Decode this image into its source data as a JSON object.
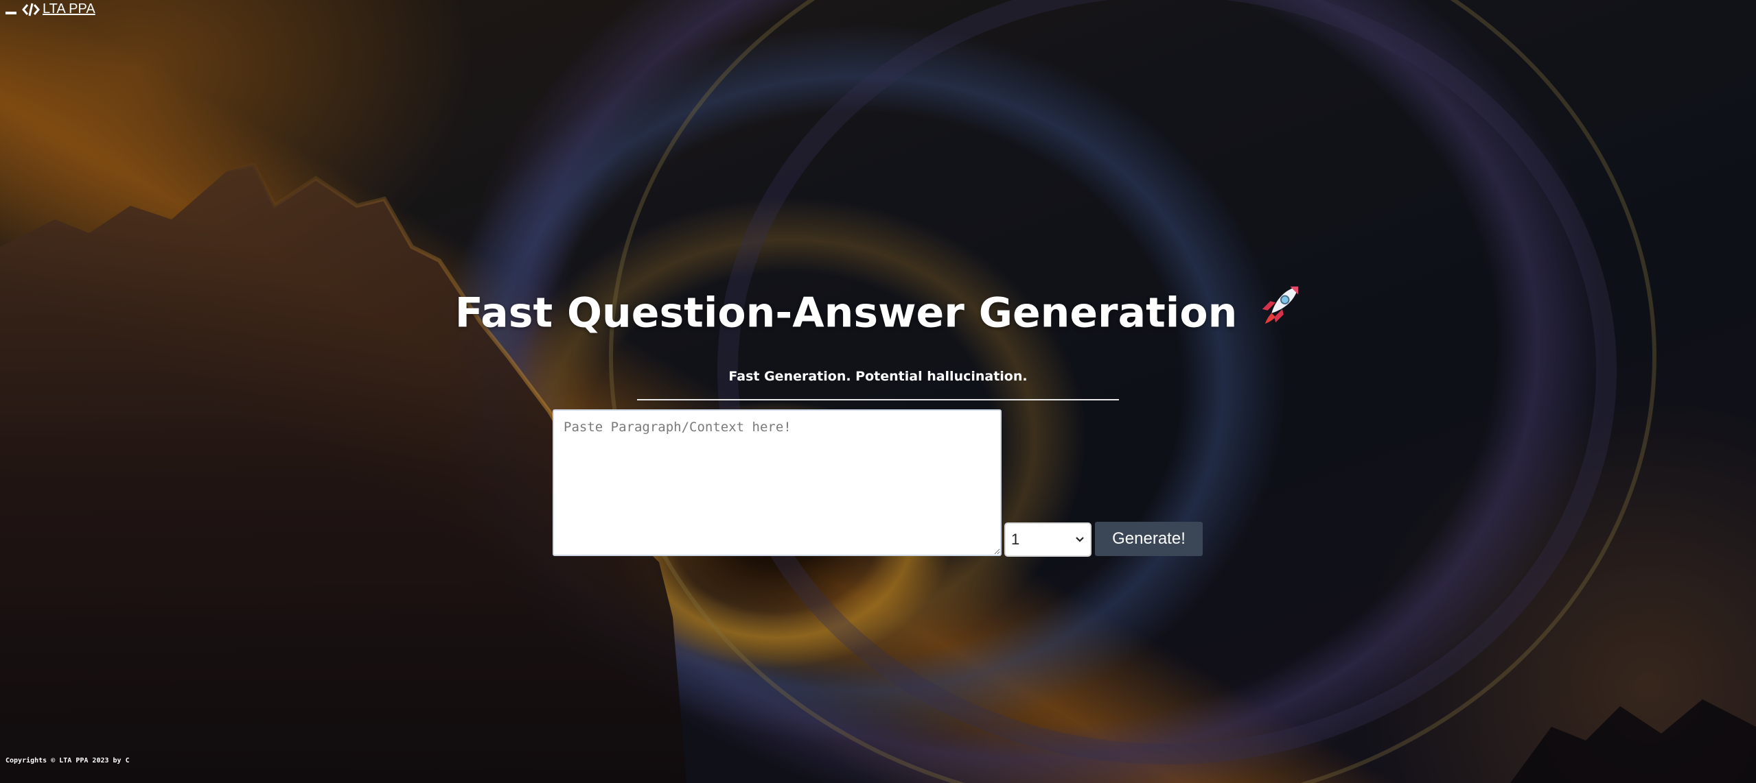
{
  "header": {
    "brand_label": "LTA PPA",
    "minimize_icon": "minimize-icon",
    "code_icon": "code-icon"
  },
  "main": {
    "title": "Fast Question-Answer Generation",
    "title_icon": "rocket-icon",
    "subtitle": "Fast Generation. Potential hallucination.",
    "context_placeholder": "Paste Paragraph/Context here!",
    "context_value": "",
    "count_selected": "1",
    "generate_label": "Generate!"
  },
  "footer": {
    "copyright": "Copyrights © LTA PPA 2023 by C"
  },
  "colors": {
    "button_bg": "#3b4656",
    "text": "#ffffff",
    "divider": "#e8e8e8"
  }
}
